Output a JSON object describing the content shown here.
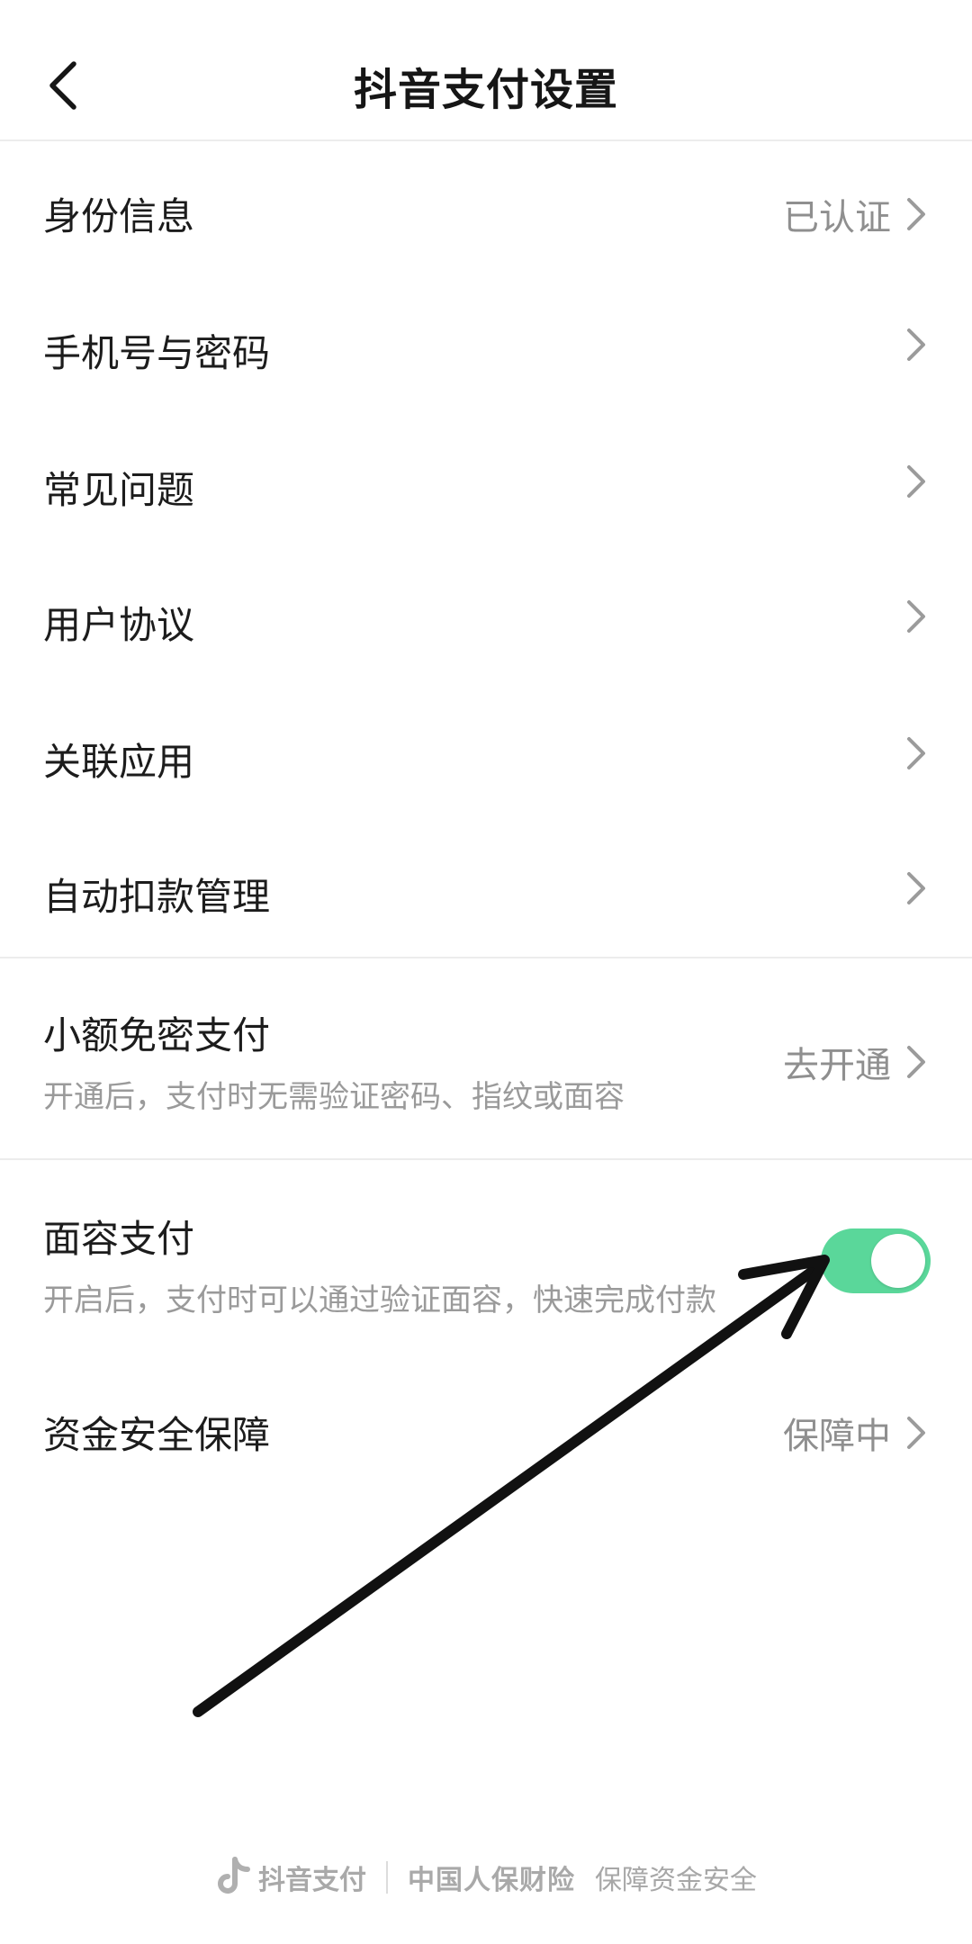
{
  "header": {
    "title": "抖音支付设置"
  },
  "menu": {
    "identity": {
      "label": "身份信息",
      "value": "已认证"
    },
    "phone_password": {
      "label": "手机号与密码"
    },
    "faq": {
      "label": "常见问题"
    },
    "agreement": {
      "label": "用户协议"
    },
    "linked_apps": {
      "label": "关联应用"
    },
    "auto_debit": {
      "label": "自动扣款管理"
    }
  },
  "small_pay": {
    "label": "小额免密支付",
    "desc": "开通后，支付时无需验证密码、指纹或面容",
    "value": "去开通"
  },
  "face_pay": {
    "label": "面容支付",
    "desc": "开启后，支付时可以通过验证面容，快速完成付款",
    "enabled": true
  },
  "fund_security": {
    "label": "资金安全保障",
    "value": "保障中"
  },
  "footer": {
    "brand": "抖音支付",
    "partner": "中国人保财险",
    "slogan": "保障资金安全"
  },
  "colors": {
    "toggle_on": "#5ad79a",
    "secondary_text": "#8f8f8f",
    "divider": "#ececec"
  }
}
